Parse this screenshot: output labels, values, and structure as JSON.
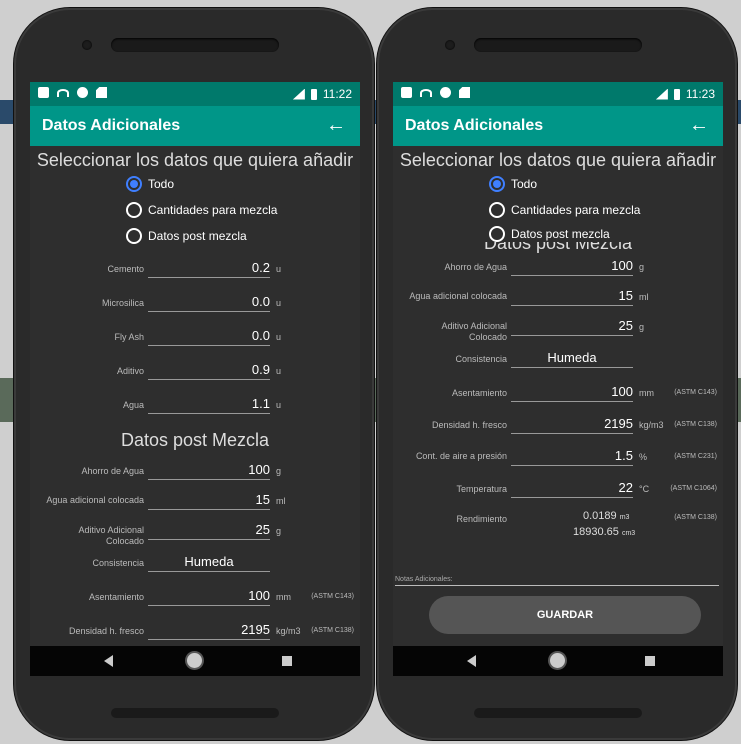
{
  "left": {
    "status_time": "11:22",
    "app_title": "Datos Adicionales",
    "heading": "Seleccionar los datos que quiera añadir",
    "radios": [
      "Todo",
      "Cantidades para mezcla",
      "Datos post mezcla"
    ],
    "mix_rows": [
      {
        "label": "Cemento",
        "value": "0.2",
        "unit": "u"
      },
      {
        "label": "Microsilica",
        "value": "0.0",
        "unit": "u"
      },
      {
        "label": "Fly Ash",
        "value": "0.0",
        "unit": "u"
      },
      {
        "label": "Aditivo",
        "value": "0.9",
        "unit": "u"
      },
      {
        "label": "Agua",
        "value": "1.1",
        "unit": "u"
      }
    ],
    "post_heading": "Datos post Mezcla",
    "post_rows": [
      {
        "label": "Ahorro de Agua",
        "value": "100",
        "unit": "g",
        "astm": ""
      },
      {
        "label": "Agua adicional colocada",
        "value": "15",
        "unit": "ml",
        "astm": ""
      },
      {
        "label": "Aditivo Adicional Colocado",
        "value": "25",
        "unit": "g",
        "astm": ""
      },
      {
        "label": "Consistencia",
        "value": "Humeda",
        "unit": "",
        "astm": ""
      },
      {
        "label": "Asentamiento",
        "value": "100",
        "unit": "mm",
        "astm": "(ASTM C143)"
      },
      {
        "label": "Densidad h. fresco",
        "value": "2195",
        "unit": "kg/m3",
        "astm": "(ASTM C138)"
      }
    ]
  },
  "right": {
    "status_time": "11:23",
    "app_title": "Datos Adicionales",
    "heading": "Seleccionar los datos que quiera añadir",
    "radios": [
      "Todo",
      "Cantidades para mezcla",
      "Datos post mezcla"
    ],
    "post_heading_cut": "Datos post Mezcla",
    "post_rows": [
      {
        "label": "Ahorro de Agua",
        "value": "100",
        "unit": "g",
        "astm": ""
      },
      {
        "label": "Agua adicional colocada",
        "value": "15",
        "unit": "ml",
        "astm": ""
      },
      {
        "label": "Aditivo Adicional Colocado",
        "value": "25",
        "unit": "g",
        "astm": ""
      },
      {
        "label": "Consistencia",
        "value": "Humeda",
        "unit": "",
        "astm": ""
      },
      {
        "label": "Asentamiento",
        "value": "100",
        "unit": "mm",
        "astm": "(ASTM C143)"
      },
      {
        "label": "Densidad h. fresco",
        "value": "2195",
        "unit": "kg/m3",
        "astm": "(ASTM C138)"
      },
      {
        "label": "Cont. de aire a presión",
        "value": "1.5",
        "unit": "%",
        "astm": "(ASTM C231)"
      },
      {
        "label": "Temperatura",
        "value": "22",
        "unit": "°C",
        "astm": "(ASTM C1064)"
      }
    ],
    "rendimiento": {
      "label": "Rendimiento",
      "value1": "0.0189",
      "unit1": "m3",
      "value2": "18930.65",
      "unit2": "cm3",
      "astm": "(ASTM C138)"
    },
    "notes_placeholder": "Notas Adicionales:",
    "save_label": "GUARDAR"
  }
}
